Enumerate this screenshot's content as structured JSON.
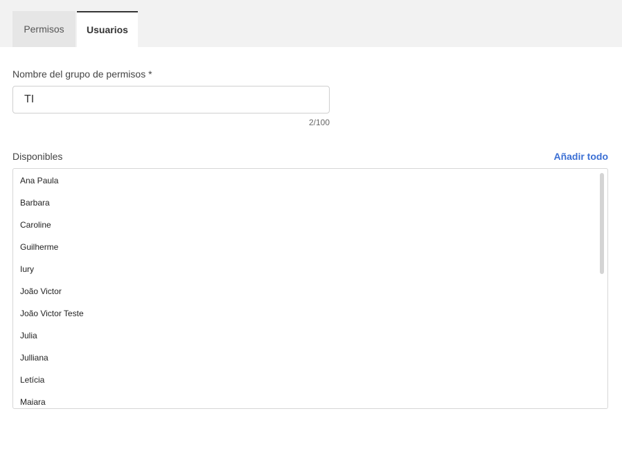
{
  "tabs": [
    {
      "label": "Permisos",
      "active": false
    },
    {
      "label": "Usuarios",
      "active": true
    }
  ],
  "form": {
    "name_label": "Nombre del grupo de permisos *",
    "name_value": "TI",
    "char_count": "2/100"
  },
  "available": {
    "label": "Disponibles",
    "add_all_label": "Añadir todo",
    "items": [
      "Ana Paula",
      "Barbara",
      "Caroline",
      "Guilherme",
      "Iury",
      "João Victor",
      "João Victor Teste",
      "Julia",
      "Julliana",
      "Letícia",
      "Maiara"
    ]
  },
  "colors": {
    "accent": "#3b6fd4",
    "tabbar_bg": "#f2f2f2",
    "active_tab_border": "#333333"
  }
}
